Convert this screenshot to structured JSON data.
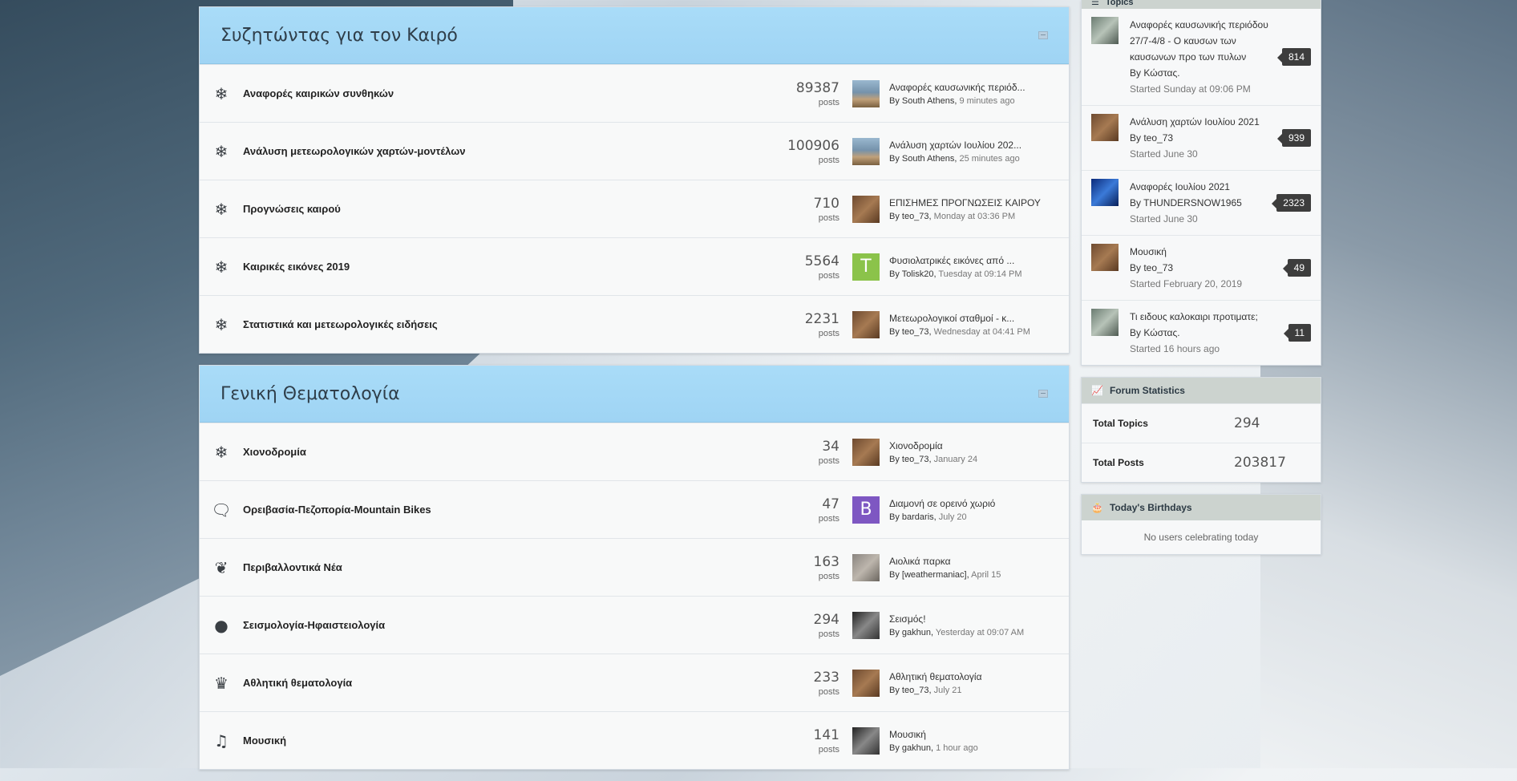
{
  "categories": [
    {
      "title": "Συζητώντας για τον Καιρό",
      "forums": [
        {
          "icon": "❄",
          "icon_name": "snowflake-icon",
          "name": "Αναφορές καιρικών συνθηκών",
          "count": "89387",
          "label": "posts",
          "avatar": "av-city",
          "avatar_letter": "",
          "last_title": "Αναφορές καυσωνικής περιόδ...",
          "last_by": "By South Athens",
          "last_time": "9 minutes ago"
        },
        {
          "icon": "❄",
          "icon_name": "snowflake-icon",
          "name": "Ανάλυση μετεωρολογικών χαρτών-μοντέλων",
          "count": "100906",
          "label": "posts",
          "avatar": "av-city",
          "avatar_letter": "",
          "last_title": "Ανάλυση χαρτών Ιουλίου 202...",
          "last_by": "By South Athens",
          "last_time": "25 minutes ago"
        },
        {
          "icon": "❄",
          "icon_name": "snowflake-icon",
          "name": "Προγνώσεις καιρού",
          "count": "710",
          "label": "posts",
          "avatar": "av-cat",
          "avatar_letter": "",
          "last_title": "ΕΠΙΣΗΜΕΣ ΠΡΟΓΝΩΣΕΙΣ ΚΑΙΡΟΥ",
          "last_by": "By teo_73",
          "last_time": "Monday at 03:36 PM"
        },
        {
          "icon": "❄",
          "icon_name": "snowflake-icon",
          "name": "Καιρικές εικόνες 2019",
          "count": "5564",
          "label": "posts",
          "avatar": "av-T",
          "avatar_letter": "T",
          "last_title": "Φυσιολατρικές εικόνες από ...",
          "last_by": "By Tolisk20",
          "last_time": "Tuesday at 09:14 PM"
        },
        {
          "icon": "❄",
          "icon_name": "snowflake-icon",
          "name": "Στατιστικά και μετεωρολογικές ειδήσεις",
          "count": "2231",
          "label": "posts",
          "avatar": "av-cat",
          "avatar_letter": "",
          "last_title": "Μετεωρολογικοί σταθμοί - κ...",
          "last_by": "By teo_73",
          "last_time": "Wednesday at 04:41 PM"
        }
      ]
    },
    {
      "title": "Γενική Θεματολογία",
      "forums": [
        {
          "icon": "❄",
          "icon_name": "snowflake-icon",
          "name": "Χιονοδρομία",
          "count": "34",
          "label": "posts",
          "avatar": "av-cat",
          "avatar_letter": "",
          "last_title": "Χιονοδρομία",
          "last_by": "By teo_73",
          "last_time": "January 24"
        },
        {
          "icon": "🗨",
          "icon_name": "comments-icon",
          "name": "Ορειβασία-Πεζοπορία-Mountain Bikes",
          "count": "47",
          "label": "posts",
          "avatar": "av-B",
          "avatar_letter": "B",
          "last_title": "Διαμονή σε ορεινό χωριό",
          "last_by": "By bardaris",
          "last_time": "July 20"
        },
        {
          "icon": "❦",
          "icon_name": "leaf-icon",
          "name": "Περιβαλλοντικά Νέα",
          "count": "163",
          "label": "posts",
          "avatar": "av-gray",
          "avatar_letter": "",
          "last_title": "Αιολικά παρκα",
          "last_by": "By [weathermaniac]",
          "last_time": "April 15"
        },
        {
          "icon": "●",
          "icon_name": "globe-icon",
          "name": "Σεισμολογία-Ηφαιστειολογία",
          "count": "294",
          "label": "posts",
          "avatar": "av-bw",
          "avatar_letter": "",
          "last_title": "Σεισμός!",
          "last_by": "By gakhun",
          "last_time": "Yesterday at 09:07 AM"
        },
        {
          "icon": "♛",
          "icon_name": "trophy-icon",
          "name": "Αθλητική θεματολογία",
          "count": "233",
          "label": "posts",
          "avatar": "av-cat",
          "avatar_letter": "",
          "last_title": "Αθλητική θεματολογία",
          "last_by": "By teo_73",
          "last_time": "July 21"
        },
        {
          "icon": "♫",
          "icon_name": "music-icon",
          "name": "Μουσική",
          "count": "141",
          "label": "posts",
          "avatar": "av-bw",
          "avatar_letter": "",
          "last_title": "Μουσική",
          "last_by": "By gakhun",
          "last_time": "1 hour ago"
        }
      ]
    }
  ],
  "sidebar": {
    "topics_header": "Topics",
    "topics": [
      {
        "avatar": "av-monkey",
        "title": "Αναφορές καυσωνικής περιόδου 27/7-4/8 - Ο καυσων των καυσωνων προ των πυλων",
        "by": "By Κώστας.",
        "started": "Started Sunday at 09:06 PM",
        "replies": "814"
      },
      {
        "avatar": "av-cat",
        "title": "Ανάλυση χαρτών Ιουλίου 2021",
        "by": "By teo_73",
        "started": "Started June 30",
        "replies": "939"
      },
      {
        "avatar": "av-blue",
        "title": "Αναφορές Ιουλίου 2021",
        "by": "By THUNDERSNOW1965",
        "started": "Started June 30",
        "replies": "2323"
      },
      {
        "avatar": "av-cat",
        "title": "Μουσική",
        "by": "By teo_73",
        "started": "Started February 20, 2019",
        "replies": "49"
      },
      {
        "avatar": "av-monkey",
        "title": "Τι ειδους καλοκαιρι προτιματε;",
        "by": "By Κώστας.",
        "started": "Started 16 hours ago",
        "replies": "11"
      }
    ],
    "stats": {
      "header": "Forum Statistics",
      "total_topics_label": "Total Topics",
      "total_topics": "294",
      "total_posts_label": "Total Posts",
      "total_posts": "203817"
    },
    "birthdays": {
      "header": "Today's Birthdays",
      "empty": "No users celebrating today"
    }
  }
}
